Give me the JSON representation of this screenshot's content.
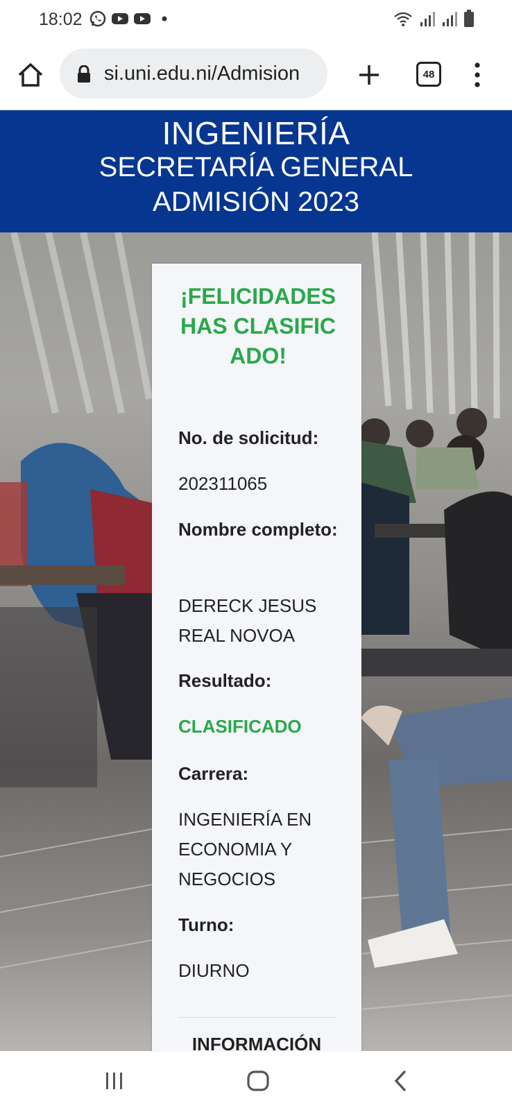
{
  "status_bar": {
    "time": "18:02",
    "left_icons": [
      "whatsapp-icon",
      "youtube-icon",
      "youtube-icon",
      "dot-icon"
    ],
    "right_icons": [
      "wifi-icon",
      "signal-icon",
      "signal-icon",
      "battery-icon"
    ]
  },
  "browser": {
    "url": "si.uni.edu.ni/Admision",
    "tab_count": "48"
  },
  "header": {
    "line1": "INGENIERÍA",
    "line2": "SECRETARÍA GENERAL",
    "line3": "ADMISIÓN 2023",
    "bg_color": "#063690"
  },
  "card": {
    "congrats": "¡FELICIDADES HAS CLASIFICADO!",
    "solicitud_label": "No. de solicitud:",
    "solicitud_value": "202311065",
    "nombre_label": "Nombre completo:",
    "nombre_value": "DERECK JESUS REAL NOVOA",
    "resultado_label": "Resultado:",
    "resultado_value": "CLASIFICADO",
    "carrera_label": "Carrera:",
    "carrera_value": "INGENIERÍA EN ECONOMIA Y NEGOCIOS",
    "turno_label": "Turno:",
    "turno_value": "DIURNO",
    "info_heading": "INFORMACIÓN",
    "accent_color": "#2aa84a"
  }
}
